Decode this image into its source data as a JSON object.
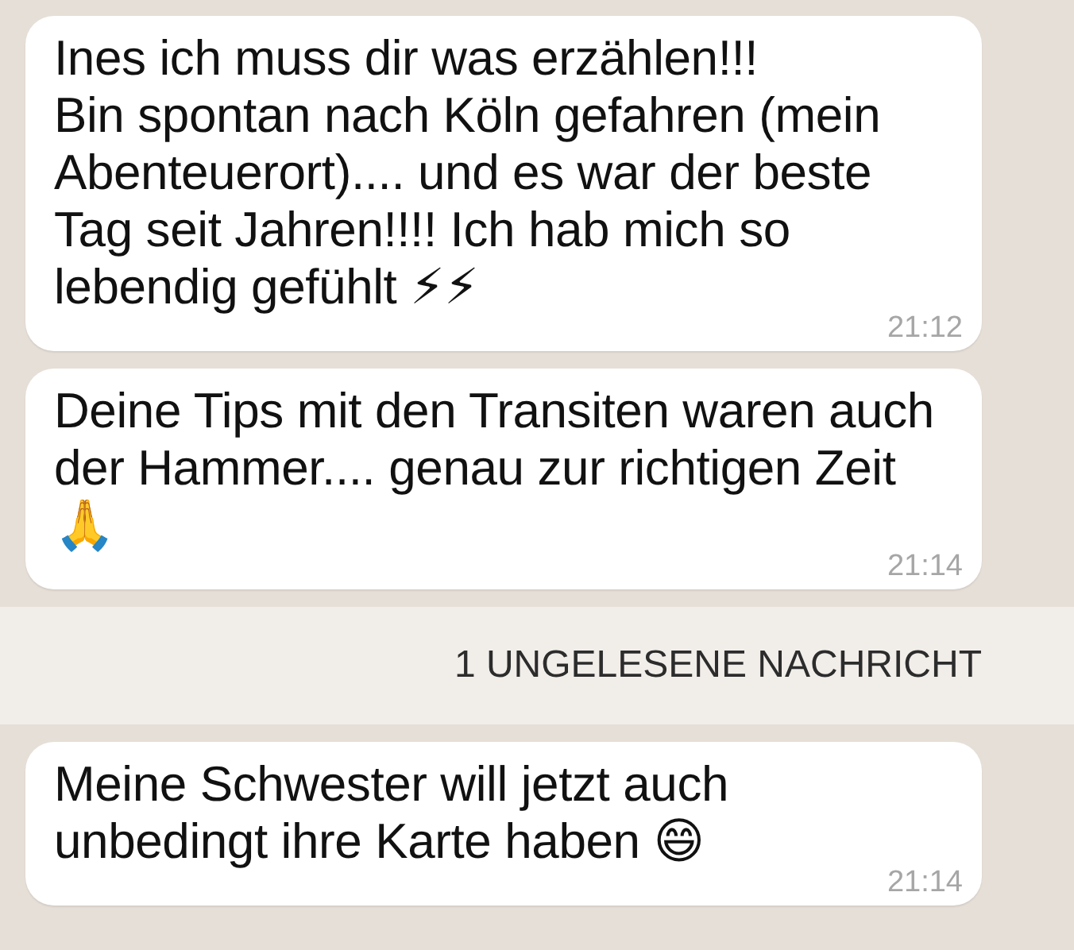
{
  "messages": [
    {
      "text": "Ines ich muss dir was erzählen!!!\nBin spontan nach Köln gefahren (mein Abenteuerort).... und es war der beste Tag seit Jahren!!!! Ich hab mich so lebendig gefühlt ⚡⚡",
      "time": "21:12"
    },
    {
      "text": "Deine Tips mit den Transiten waren auch der Hammer.... genau zur richtigen Zeit 🙏",
      "time": "21:14"
    }
  ],
  "unread_banner": "1 UNGELESENE NACHRICHT",
  "new_messages": [
    {
      "text": "Meine Schwester will jetzt auch unbedingt ihre Karte haben 😄",
      "time": "21:14"
    }
  ]
}
